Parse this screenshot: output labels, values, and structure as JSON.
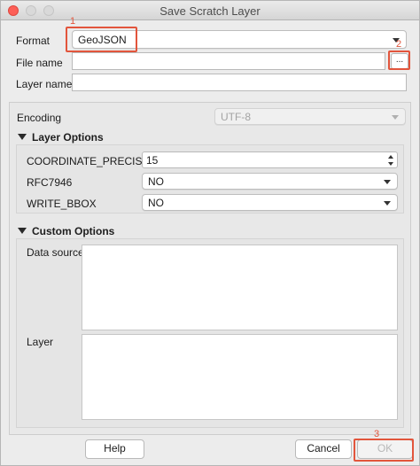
{
  "window": {
    "title": "Save Scratch Layer"
  },
  "form": {
    "format_label": "Format",
    "format_value": "GeoJSON",
    "file_name_label": "File name",
    "file_name_value": "",
    "browse_label": "...",
    "layer_name_label": "Layer name",
    "layer_name_value": ""
  },
  "encoding": {
    "label": "Encoding",
    "value": "UTF-8"
  },
  "layer_options": {
    "title": "Layer Options",
    "coordinate_precision_label": "COORDINATE_PRECISION",
    "coordinate_precision_value": "15",
    "rfc7946_label": "RFC7946",
    "rfc7946_value": "NO",
    "write_bbox_label": "WRITE_BBOX",
    "write_bbox_value": "NO"
  },
  "custom_options": {
    "title": "Custom Options",
    "data_source_label": "Data source",
    "data_source_value": "",
    "layer_label": "Layer",
    "layer_value": ""
  },
  "buttons": {
    "help": "Help",
    "cancel": "Cancel",
    "ok": "OK"
  },
  "annotations": {
    "marker1": "1",
    "marker2": "2",
    "marker3": "3",
    "color": "#e2553c"
  }
}
